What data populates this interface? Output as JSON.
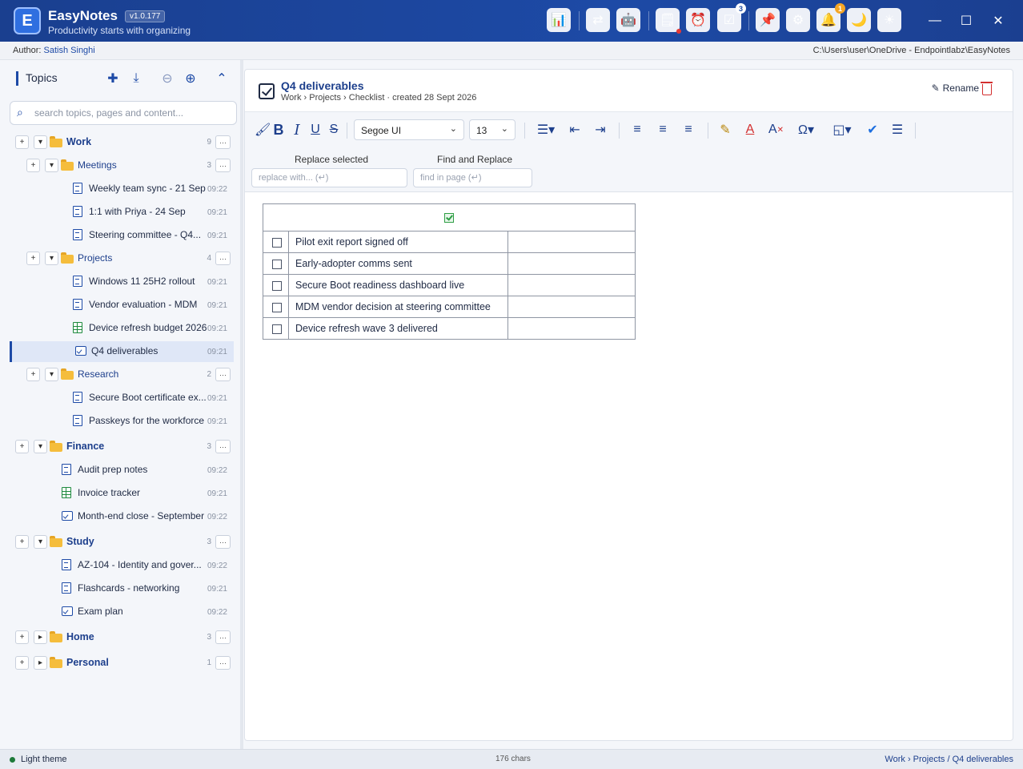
{
  "app": {
    "logo_letter": "E",
    "name": "EasyNotes",
    "version": "v1.0.177",
    "tagline": "Productivity starts with organizing"
  },
  "titlebar_icons": [
    {
      "name": "dashboard-icon",
      "glyph": "📊"
    },
    {
      "name": "sync-icon",
      "glyph": "⇄"
    },
    {
      "name": "robot-icon",
      "glyph": "🤖"
    },
    {
      "name": "notes-list-icon",
      "glyph": "🗒"
    },
    {
      "name": "alarm-clock-icon",
      "glyph": "⏰"
    },
    {
      "name": "tasks-icon",
      "glyph": "☑",
      "badge": "3"
    },
    {
      "name": "pin-icon",
      "glyph": "📌"
    },
    {
      "name": "settings-gear-icon",
      "glyph": "⚙"
    },
    {
      "name": "bell-icon",
      "glyph": "🔔",
      "badge": "1"
    },
    {
      "name": "moon-icon",
      "glyph": "🌙"
    },
    {
      "name": "sun-icon",
      "glyph": "☀"
    }
  ],
  "author": {
    "label": "Author:",
    "name": "Satish Singhi"
  },
  "storage_path": "C:\\Users\\user\\OneDrive - Endpointlabz\\EasyNotes",
  "sidebar": {
    "title": "Topics",
    "search_placeholder": "search topics, pages and content...",
    "tree": [
      {
        "type": "folder",
        "level": 0,
        "label": "Work",
        "count": "9",
        "expanded": true
      },
      {
        "type": "folder",
        "level": 1,
        "label": "Meetings",
        "count": "3",
        "expanded": true
      },
      {
        "type": "page",
        "level": 2,
        "icon": "doc",
        "label": "Weekly team sync - 21 Sep",
        "time": "09:22"
      },
      {
        "type": "page",
        "level": 2,
        "icon": "doc",
        "label": "1:1 with Priya - 24 Sep",
        "time": "09:21"
      },
      {
        "type": "page",
        "level": 2,
        "icon": "doc",
        "label": "Steering committee - Q4...",
        "time": "09:21"
      },
      {
        "type": "folder",
        "level": 1,
        "label": "Projects",
        "count": "4",
        "expanded": true
      },
      {
        "type": "page",
        "level": 2,
        "icon": "doc",
        "label": "Windows 11 25H2 rollout",
        "time": "09:21"
      },
      {
        "type": "page",
        "level": 2,
        "icon": "doc",
        "label": "Vendor evaluation - MDM",
        "time": "09:21"
      },
      {
        "type": "page",
        "level": 2,
        "icon": "sheet",
        "label": "Device refresh budget 2026",
        "time": "09:21"
      },
      {
        "type": "page",
        "level": 2,
        "icon": "check",
        "label": "Q4 deliverables",
        "time": "09:21",
        "selected": true
      },
      {
        "type": "folder",
        "level": 1,
        "label": "Research",
        "count": "2",
        "expanded": true
      },
      {
        "type": "page",
        "level": 2,
        "icon": "doc",
        "label": "Secure Boot certificate ex...",
        "time": "09:21"
      },
      {
        "type": "page",
        "level": 2,
        "icon": "doc",
        "label": "Passkeys for the workforce",
        "time": "09:21"
      },
      {
        "type": "folder",
        "level": 0,
        "label": "Finance",
        "count": "3",
        "expanded": true
      },
      {
        "type": "page",
        "level": 1,
        "icon": "doc",
        "label": "Audit prep notes",
        "time": "09:22"
      },
      {
        "type": "page",
        "level": 1,
        "icon": "sheet",
        "label": "Invoice tracker",
        "time": "09:21"
      },
      {
        "type": "page",
        "level": 1,
        "icon": "check",
        "label": "Month-end close - September",
        "time": "09:22"
      },
      {
        "type": "folder",
        "level": 0,
        "label": "Study",
        "count": "3",
        "expanded": true
      },
      {
        "type": "page",
        "level": 1,
        "icon": "doc",
        "label": "AZ-104 - Identity and gover...",
        "time": "09:22"
      },
      {
        "type": "page",
        "level": 1,
        "icon": "doc",
        "label": "Flashcards - networking",
        "time": "09:21"
      },
      {
        "type": "page",
        "level": 1,
        "icon": "check",
        "label": "Exam plan",
        "time": "09:22"
      },
      {
        "type": "folder",
        "level": 0,
        "label": "Home",
        "count": "3",
        "expanded": false
      },
      {
        "type": "folder",
        "level": 0,
        "label": "Personal",
        "count": "1",
        "expanded": false
      }
    ]
  },
  "page": {
    "title": "Q4 deliverables",
    "meta": "Work › Projects  ›  Checklist  ·  created 28 Sept 2026",
    "rename_label": "Rename",
    "font_family": "Segoe UI",
    "font_size": "13",
    "replace_label": "Replace selected",
    "replace_placeholder": "replace with... (↵)",
    "find_label": "Find and Replace",
    "find_placeholder": "find in page (↵)",
    "checklist": [
      {
        "text": "Pilot exit report signed off",
        "checked": false
      },
      {
        "text": "Early-adopter comms sent",
        "checked": false
      },
      {
        "text": "Secure Boot readiness dashboard live",
        "checked": false
      },
      {
        "text": "MDM vendor decision at steering committee",
        "checked": false
      },
      {
        "text": "Device refresh wave 3 delivered",
        "checked": false
      }
    ]
  },
  "status": {
    "theme": "Light theme",
    "chars": "176 chars",
    "breadcrumb": "Work › Projects / Q4 deliverables"
  },
  "colors": {
    "accent": "#1d4aa6",
    "folder": "#f5bd3c",
    "sheet": "#1e8a3e",
    "danger": "#d32f2f"
  }
}
